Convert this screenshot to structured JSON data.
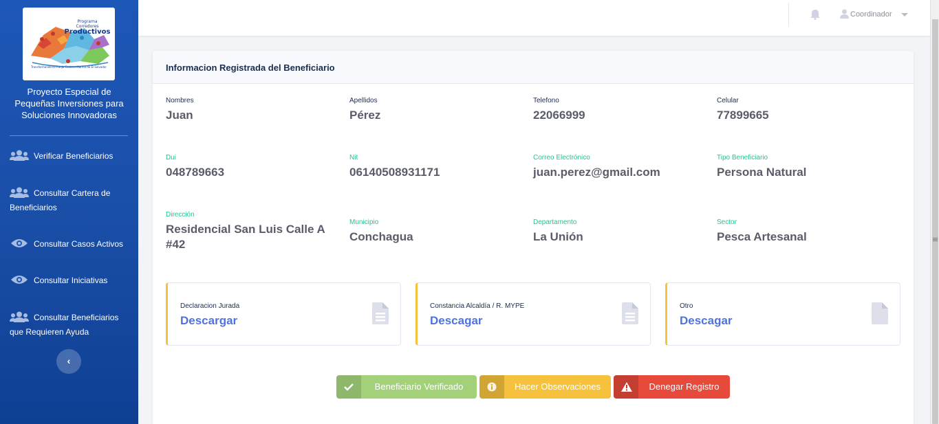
{
  "sidebar": {
    "logo": {
      "program": "Programa",
      "line1": "Corredores",
      "line2": "Productivos",
      "tagline": "Transformando la Franja Costero-Marina de El Salvador"
    },
    "title": "Proyecto Especial de Pequeñas Inversiones para Soluciones Innovadoras",
    "items": [
      {
        "label": "Verificar Beneficiarios",
        "icon": "users-icon"
      },
      {
        "label": "Consultar Cartera de Beneficiarios",
        "icon": "users-icon"
      },
      {
        "label": "Consultar Casos Activos",
        "icon": "eye-icon"
      },
      {
        "label": "Consultar Iniciativas",
        "icon": "eye-icon"
      },
      {
        "label": "Consultar Beneficiarios que Requieren Ayuda",
        "icon": "users-icon"
      }
    ],
    "toggle_icon": "chevron-left-icon",
    "toggle_glyph": "‹"
  },
  "topbar": {
    "user_label": "Coordinador",
    "bell_icon": "bell-icon",
    "user_icon": "user-icon"
  },
  "card": {
    "title": "Informacion Registrada del Beneficiario",
    "fields": [
      {
        "label": "Nombres",
        "value": "Juan"
      },
      {
        "label": "Apellidos",
        "value": "Pérez"
      },
      {
        "label": "Telefono",
        "value": "22066999"
      },
      {
        "label": "Celular",
        "value": "77899665"
      },
      {
        "label": "Dui",
        "value": "048789663"
      },
      {
        "label": "Nit",
        "value": "06140508931171"
      },
      {
        "label": "Correo Electrónico",
        "value": "juan.perez@gmail.com"
      },
      {
        "label": "Tipo Beneficiario",
        "value": "Persona Natural"
      },
      {
        "label": "Dirección",
        "value": "Residencial San Luis Calle A #42"
      },
      {
        "label": "Municipio",
        "value": "Conchagua"
      },
      {
        "label": "Departamento",
        "value": "La Unión"
      },
      {
        "label": "Sector",
        "value": "Pesca Artesanal"
      }
    ],
    "documents": [
      {
        "label": "Declaracion Jurada",
        "link": "Descargar",
        "icon": "file-text-icon"
      },
      {
        "label": "Constancia Alcaldía / R. MYPE",
        "link": "Descagar",
        "icon": "file-text-icon"
      },
      {
        "label": "Otro",
        "link": "Descagar",
        "icon": "file-icon"
      }
    ],
    "actions": {
      "verify": "Beneficiario Verificado",
      "observe": "Hacer Observaciones",
      "deny": "Denegar Registro"
    }
  },
  "colors": {
    "sidebar": "#1d57b8",
    "primary": "#4e73df",
    "success": "#a3d17a",
    "warning": "#f6c23e",
    "danger": "#e74a3b",
    "label_green": "#1cc88a"
  }
}
